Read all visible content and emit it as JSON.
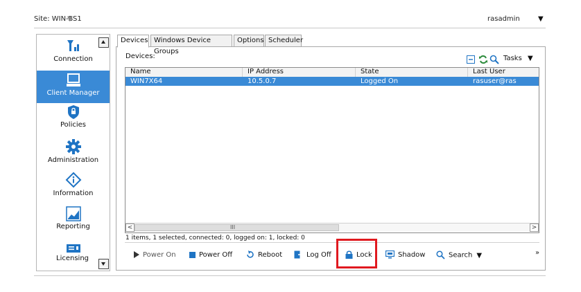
{
  "header": {
    "site_label": "Site: WIN-BS1",
    "user_label": "rasadmin"
  },
  "sidebar": {
    "items": [
      {
        "label": "Connection",
        "icon": "connection-signal-icon",
        "active": false
      },
      {
        "label": "Client Manager",
        "icon": "monitor-icon",
        "active": true
      },
      {
        "label": "Policies",
        "icon": "shield-lock-icon",
        "active": false
      },
      {
        "label": "Administration",
        "icon": "gear-icon",
        "active": false
      },
      {
        "label": "Information",
        "icon": "info-diamond-icon",
        "active": false
      },
      {
        "label": "Reporting",
        "icon": "chart-icon",
        "active": false
      },
      {
        "label": "Licensing",
        "icon": "license-icon",
        "active": false
      }
    ]
  },
  "tabs": [
    {
      "label": "Devices",
      "active": true
    },
    {
      "label": "Windows Device Groups",
      "active": false
    },
    {
      "label": "Options",
      "active": false
    },
    {
      "label": "Scheduler",
      "active": false
    }
  ],
  "devices_panel": {
    "title": "Devices:",
    "tasks_label": "Tasks",
    "columns": [
      "Name",
      "IP Address",
      "State",
      "Last User"
    ],
    "rows": [
      {
        "name": "WIN7X64",
        "ip": "10.5.0.7",
        "state": "Logged On",
        "last_user": "rasuser@ras",
        "selected": true
      }
    ],
    "scroll_grip": "III",
    "status": "1 items, 1 selected, connected: 0, logged on: 1, locked: 0"
  },
  "toolbar": {
    "power_on": "Power On",
    "power_off": "Power Off",
    "reboot": "Reboot",
    "log_off": "Log Off",
    "lock": "Lock",
    "shadow": "Shadow",
    "search": "Search",
    "overflow": "»"
  },
  "colors": {
    "selection": "#3a8ad6",
    "highlight_box": "#e0191f",
    "icon_blue": "#1f74c4"
  }
}
